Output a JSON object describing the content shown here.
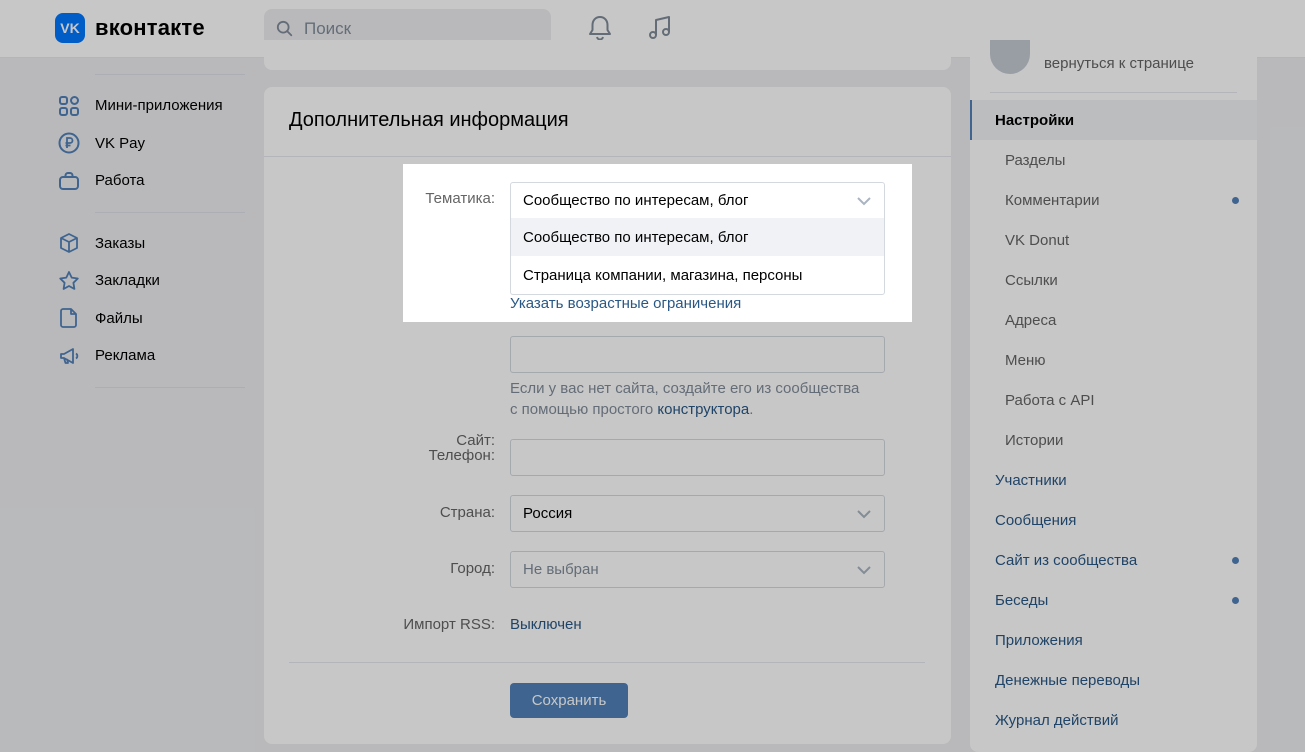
{
  "header": {
    "logo_text": "вконтакте",
    "logo_mark": "VK",
    "search_placeholder": "Поиск",
    "icons": [
      "bell-icon",
      "music-icon",
      "search-icon"
    ]
  },
  "leftnav": {
    "items": [
      {
        "label": "Мини-приложения",
        "icon": "apps-icon"
      },
      {
        "label": "VK Pay",
        "icon": "ruble-icon"
      },
      {
        "label": "Работа",
        "icon": "briefcase-icon"
      },
      {
        "label": "Заказы",
        "icon": "box-icon"
      },
      {
        "label": "Закладки",
        "icon": "star-icon"
      },
      {
        "label": "Файлы",
        "icon": "file-icon"
      },
      {
        "label": "Реклама",
        "icon": "megaphone-icon"
      }
    ]
  },
  "main": {
    "title": "Дополнительная информация",
    "topic": {
      "label": "Тематика:",
      "value": "Сообщество по интересам, блог",
      "options": [
        "Сообщество по интересам, блог",
        "Страница компании, магазина, персоны"
      ]
    },
    "age_link": "Указать возрастные ограничения",
    "site": {
      "label": "Сайт:",
      "value": "",
      "hint_prefix": "Если у вас нет сайта, создайте его из сообщества",
      "hint_middle": "с помощью простого ",
      "hint_link": "конструктора",
      "hint_suffix": "."
    },
    "phone": {
      "label": "Телефон:",
      "value": ""
    },
    "country": {
      "label": "Страна:",
      "value": "Россия"
    },
    "city": {
      "label": "Город:",
      "value": "Не выбран"
    },
    "rss": {
      "label": "Импорт RSS:",
      "value": "Выключен"
    },
    "save_label": "Сохранить"
  },
  "rightmenu": {
    "back_label": "вернуться к странице",
    "items": [
      {
        "label": "Настройки",
        "kind": "active",
        "dot": false
      },
      {
        "label": "Разделы",
        "kind": "sub",
        "dot": false
      },
      {
        "label": "Комментарии",
        "kind": "sub",
        "dot": true
      },
      {
        "label": "VK Donut",
        "kind": "sub",
        "dot": false
      },
      {
        "label": "Ссылки",
        "kind": "sub",
        "dot": false
      },
      {
        "label": "Адреса",
        "kind": "sub",
        "dot": false
      },
      {
        "label": "Меню",
        "kind": "sub",
        "dot": false
      },
      {
        "label": "Работа с API",
        "kind": "sub",
        "dot": false
      },
      {
        "label": "Истории",
        "kind": "sub",
        "dot": false
      },
      {
        "label": "Участники",
        "kind": "top",
        "dot": false
      },
      {
        "label": "Сообщения",
        "kind": "top",
        "dot": false
      },
      {
        "label": "Сайт из сообщества",
        "kind": "top",
        "dot": true
      },
      {
        "label": "Беседы",
        "kind": "top",
        "dot": true
      },
      {
        "label": "Приложения",
        "kind": "top",
        "dot": false
      },
      {
        "label": "Денежные переводы",
        "kind": "top",
        "dot": false
      },
      {
        "label": "Журнал действий",
        "kind": "top",
        "dot": false
      }
    ]
  },
  "colors": {
    "accent": "#5181b8",
    "link": "#2a5885",
    "background": "#edeef0"
  }
}
